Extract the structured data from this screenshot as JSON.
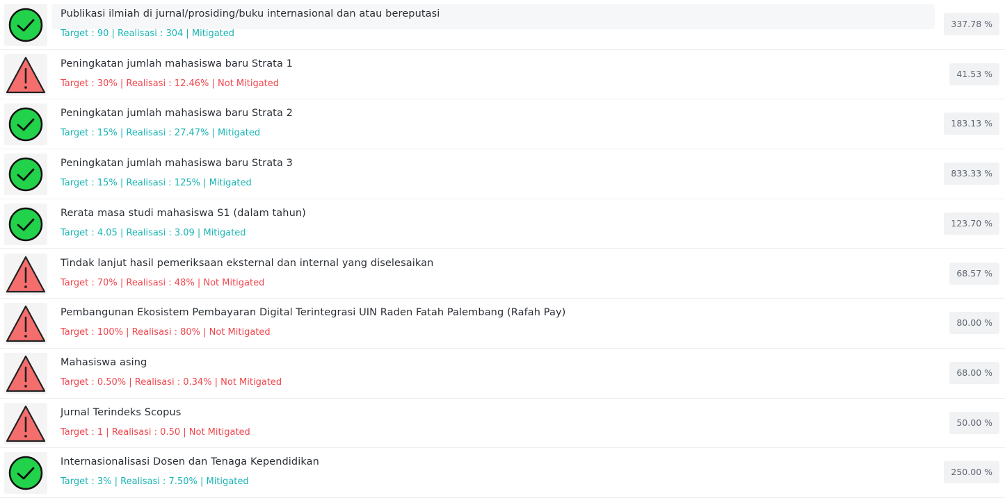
{
  "rows": [
    {
      "status": "mitigated",
      "title": "Publikasi ilmiah di jurnal/prosiding/buku internasional dan atau bereputasi",
      "meta": "Target : 90 | Realisasi : 304 | Mitigated",
      "percent": "337.78 %"
    },
    {
      "status": "not_mitigated",
      "title": "Peningkatan jumlah mahasiswa baru Strata 1",
      "meta": "Target : 30% | Realisasi : 12.46% | Not Mitigated",
      "percent": "41.53 %"
    },
    {
      "status": "mitigated",
      "title": "Peningkatan jumlah mahasiswa baru Strata 2",
      "meta": "Target : 15% | Realisasi : 27.47% | Mitigated",
      "percent": "183.13 %"
    },
    {
      "status": "mitigated",
      "title": "Peningkatan jumlah mahasiswa baru Strata 3",
      "meta": "Target : 15% | Realisasi : 125% | Mitigated",
      "percent": "833.33 %"
    },
    {
      "status": "mitigated",
      "title": "Rerata masa studi mahasiswa S1 (dalam tahun)",
      "meta": "Target : 4.05 | Realisasi : 3.09 | Mitigated",
      "percent": "123.70 %"
    },
    {
      "status": "not_mitigated",
      "title": "Tindak lanjut hasil pemeriksaan eksternal dan internal yang diselesaikan",
      "meta": "Target : 70% | Realisasi : 48% | Not Mitigated",
      "percent": "68.57 %"
    },
    {
      "status": "not_mitigated",
      "title": "Pembangunan Ekosistem Pembayaran Digital Terintegrasi UIN Raden Fatah Palembang (Rafah Pay)",
      "meta": "Target : 100% | Realisasi : 80% | Not Mitigated",
      "percent": "80.00 %"
    },
    {
      "status": "not_mitigated",
      "title": "Mahasiswa asing",
      "meta": "Target : 0.50% | Realisasi : 0.34% | Not Mitigated",
      "percent": "68.00 %"
    },
    {
      "status": "not_mitigated",
      "title": "Jurnal Terindeks Scopus",
      "meta": "Target : 1 | Realisasi : 0.50 | Not Mitigated",
      "percent": "50.00 %"
    },
    {
      "status": "mitigated",
      "title": "Internasionalisasi Dosen dan Tenaga Kependidikan",
      "meta": "Target : 3% | Realisasi : 7.50% | Mitigated",
      "percent": "250.00 %"
    }
  ],
  "icons": {
    "mitigated": "check-circle-icon",
    "not_mitigated": "warning-triangle-icon"
  },
  "colors": {
    "mitigated_text": "#1ab4b4",
    "not_mitigated_text": "#f0474e",
    "check_fill": "#22d24a",
    "warning_fill": "#f56e6e"
  }
}
